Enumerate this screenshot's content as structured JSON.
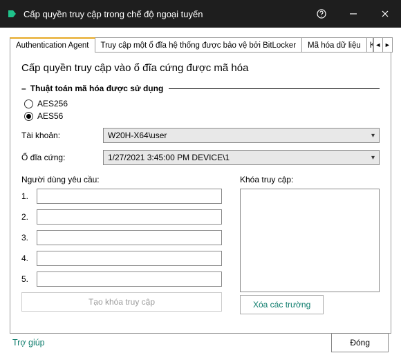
{
  "window": {
    "title": "Cấp quyền truy cập trong chế độ ngoại tuyến"
  },
  "tabs": {
    "t0": "Authentication Agent",
    "t1": "Truy cập một ổ đĩa hệ thống được bảo vệ bởi BitLocker",
    "t2": "Mã hóa dữ liệu",
    "t3": "Ki"
  },
  "panel": {
    "title": "Cấp quyền truy cập vào ổ đĩa cứng được mã hóa",
    "algo_legend": "Thuật toán mã hóa được sử dụng",
    "algo_aes256": "AES256",
    "algo_aes56": "AES56",
    "account_label": "Tài khoản:",
    "account_value": "W20H-X64\\user",
    "hdd_label": "Ổ đĩa cứng:",
    "hdd_value": "1/27/2021 3:45:00 PM  DEVICE\\1",
    "userreq_label": "Người dùng yêu cầu:",
    "key_label": "Khóa truy cập:",
    "rows": {
      "r1": "1.",
      "r2": "2.",
      "r3": "3.",
      "r4": "4.",
      "r5": "5."
    },
    "gen_btn": "Tạo khóa truy cập",
    "clear_btn": "Xóa các trường"
  },
  "footer": {
    "help": "Trợ giúp",
    "close": "Đóng"
  }
}
